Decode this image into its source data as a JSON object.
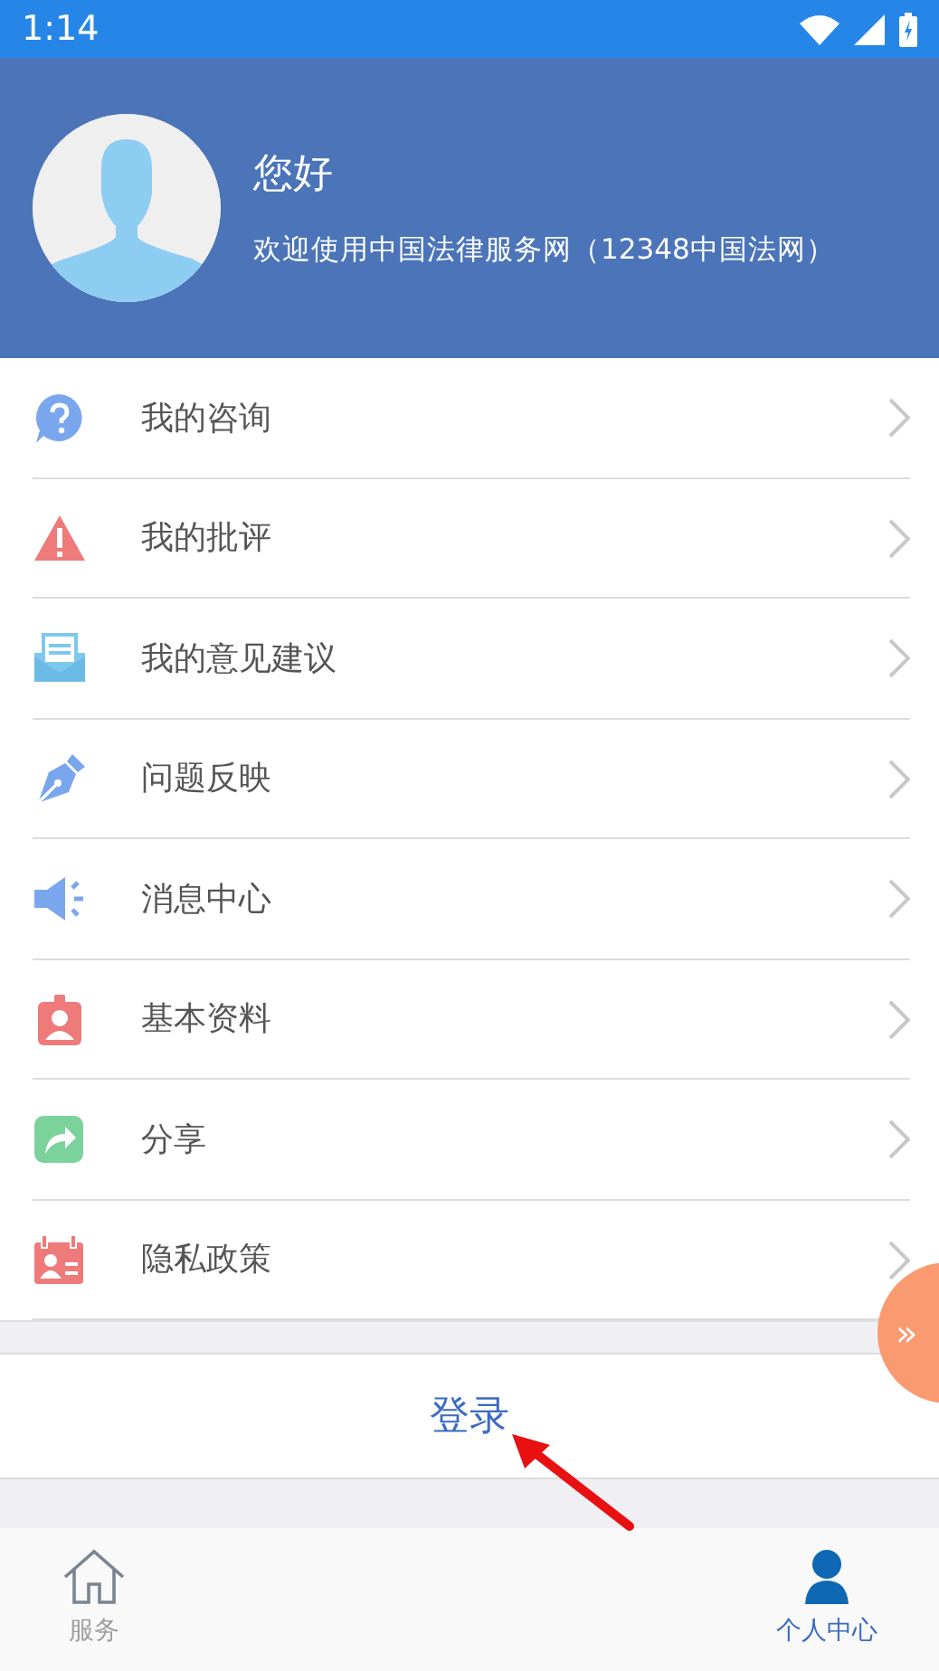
{
  "status_bar": {
    "time": "1:14"
  },
  "profile": {
    "greeting": "您好",
    "welcome": "欢迎使用中国法律服务网（12348中国法网）"
  },
  "menu": [
    {
      "kind": "question",
      "label": "我的咨询"
    },
    {
      "kind": "warning",
      "label": "我的批评"
    },
    {
      "kind": "mail",
      "label": "我的意见建议"
    },
    {
      "kind": "pen",
      "label": "问题反映"
    },
    {
      "kind": "speaker",
      "label": "消息中心"
    },
    {
      "kind": "badge",
      "label": "基本资料"
    },
    {
      "kind": "share",
      "label": "分享"
    },
    {
      "kind": "contact",
      "label": "隐私政策"
    }
  ],
  "login_button": "登录",
  "float_button": "»",
  "tabs": [
    {
      "kind": "home",
      "label": "服务",
      "selected": false
    },
    {
      "kind": "person",
      "label": "个人中心",
      "selected": true
    }
  ]
}
